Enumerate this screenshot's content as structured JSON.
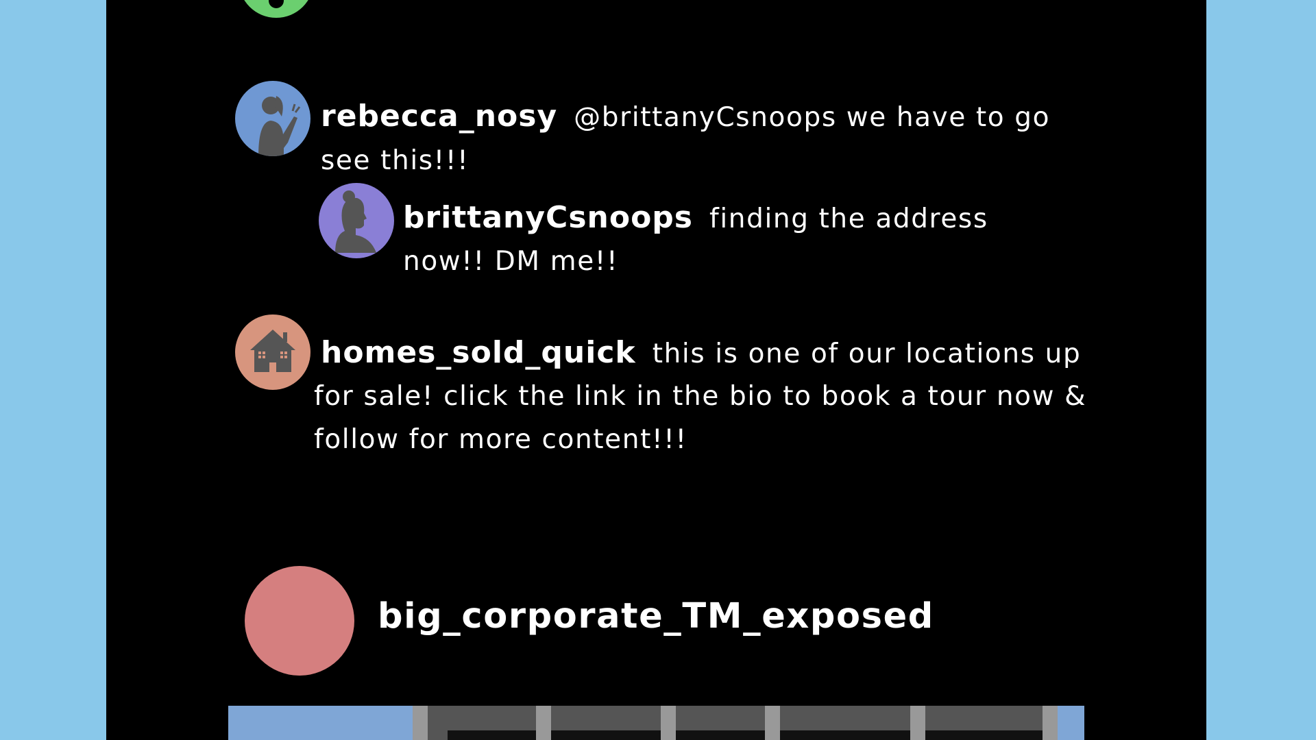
{
  "comments": [
    {
      "username": "rebecca_nosy",
      "line1": "@brittanyCsnoops we have to go",
      "line2": "see this!!!",
      "avatar_color": "#6f98d3",
      "avatar_icon": "woman-ponytail-waving-icon",
      "replies": [
        {
          "username": "brittanyCsnoops",
          "line1": "finding the address",
          "line2": "now!! DM me!!",
          "avatar_color": "#8a7fd6",
          "avatar_icon": "woman-bun-profile-icon"
        }
      ]
    },
    {
      "username": "homes_sold_quick",
      "line1": "this is one of our locations up",
      "line2": "for sale! click the link in the bio to book a tour now &",
      "line3": "follow for more content!!!",
      "avatar_color": "#d7957e",
      "avatar_icon": "house-icon"
    }
  ],
  "post": {
    "username": "big_corporate_TM_exposed",
    "avatar_color": "#d57f7f"
  },
  "colors": {
    "background": "#89c8ea",
    "feed": "#000000",
    "text": "#ffffff"
  }
}
